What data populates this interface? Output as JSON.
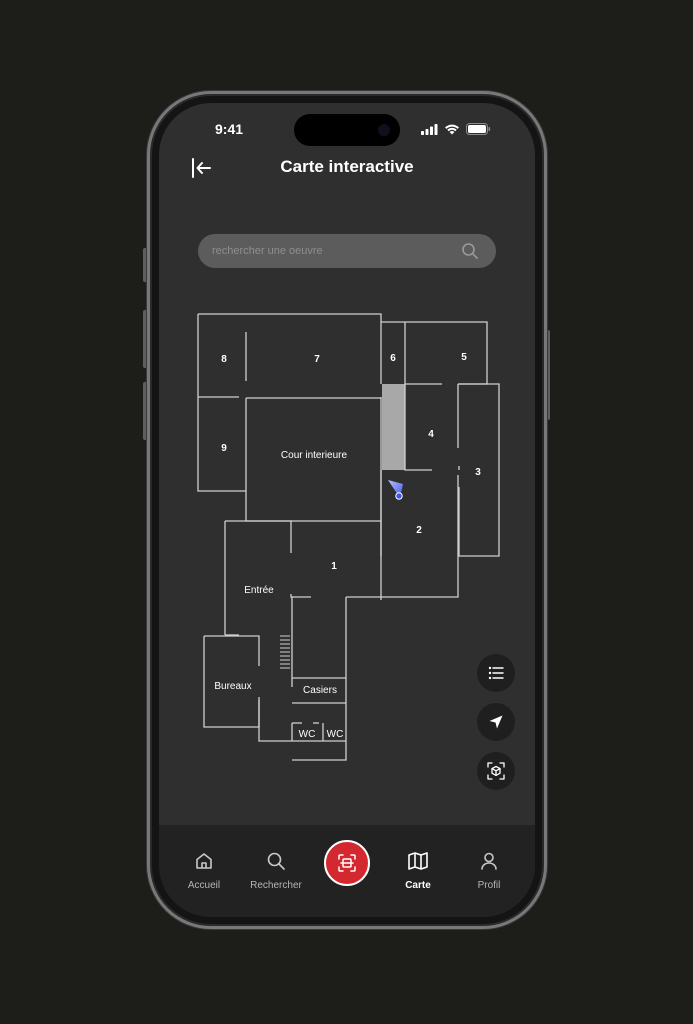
{
  "status": {
    "time": "9:41"
  },
  "header": {
    "title": "Carte interactive"
  },
  "search": {
    "placeholder": "rechercher une oeuvre"
  },
  "map": {
    "rooms": {
      "r1": "1",
      "r2": "2",
      "r3": "3",
      "r4": "4",
      "r5": "5",
      "r6": "6",
      "r7": "7",
      "r8": "8",
      "r9": "9",
      "cour": "Cour interieure",
      "entree": "Entrée",
      "bureaux": "Bureaux",
      "casiers": "Casiers",
      "wc1": "WC",
      "wc2": "WC"
    }
  },
  "fabs": {
    "list": "list-icon",
    "locate": "navigation-arrow-icon",
    "view3d": "3d-cube-icon"
  },
  "tabbar": {
    "home": "Accueil",
    "search": "Rechercher",
    "map": "Carte",
    "profile": "Profil"
  },
  "colors": {
    "accent": "#d3282f",
    "background": "#2f2f2f",
    "walls": "#cfcfcf",
    "location": "#5b6cff"
  }
}
